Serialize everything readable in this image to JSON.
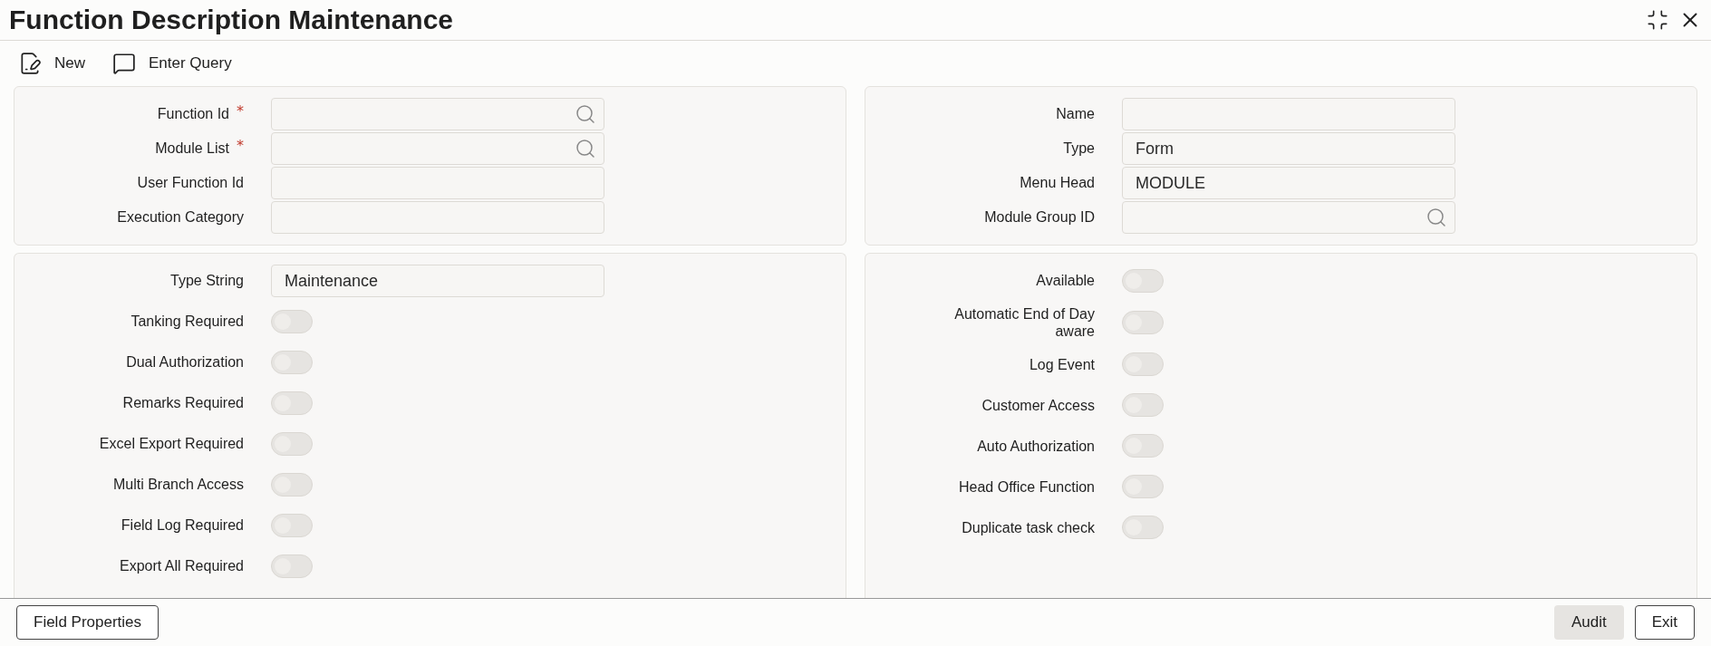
{
  "window": {
    "title": "Function Description Maintenance"
  },
  "toolbar": [
    {
      "kind": "new",
      "label": "New"
    },
    {
      "kind": "query",
      "label": "Enter Query"
    }
  ],
  "header_left": [
    {
      "label": "Function Id",
      "required_mark": "*",
      "lookup": true
    },
    {
      "label": "Module List",
      "required_mark": "*",
      "lookup": true
    },
    {
      "label": "User Function Id",
      "lookup": false
    },
    {
      "label": "Execution Category",
      "lookup": false
    }
  ],
  "header_right": [
    {
      "label": "Name",
      "lookup": false
    },
    {
      "label": "Type",
      "value": "Form",
      "lookup": false
    },
    {
      "label": "Menu Head",
      "value": "MODULE",
      "lookup": false
    },
    {
      "label": "Module Group ID",
      "lookup": true
    }
  ],
  "details_left": [
    {
      "kind": "field",
      "label": "Type String",
      "value": "Maintenance"
    },
    {
      "kind": "toggle",
      "label": "Tanking Required",
      "on": false
    },
    {
      "kind": "toggle",
      "label": "Dual Authorization",
      "on": false
    },
    {
      "kind": "toggle",
      "label": "Remarks Required",
      "on": false
    },
    {
      "kind": "toggle",
      "label": "Excel Export Required",
      "on": false
    },
    {
      "kind": "toggle",
      "label": "Multi Branch Access",
      "on": false
    },
    {
      "kind": "toggle",
      "label": "Field Log Required",
      "on": false
    },
    {
      "kind": "toggle",
      "label": "Export All Required",
      "on": false
    }
  ],
  "details_right": [
    {
      "kind": "toggle",
      "label": "Available",
      "on": false
    },
    {
      "kind": "toggle",
      "label": "Automatic End of Day aware",
      "on": false
    },
    {
      "kind": "toggle",
      "label": "Log Event",
      "on": false
    },
    {
      "kind": "toggle",
      "label": "Customer Access",
      "on": false
    },
    {
      "kind": "toggle",
      "label": "Auto Authorization",
      "on": false
    },
    {
      "kind": "toggle",
      "label": "Head Office Function",
      "on": false
    },
    {
      "kind": "toggle",
      "label": "Duplicate task check",
      "on": false
    }
  ],
  "footer": {
    "left": [
      {
        "kind": "outlined",
        "label": "Field Properties"
      }
    ],
    "right": [
      {
        "kind": "shaded",
        "label": "Audit"
      },
      {
        "kind": "outlined",
        "label": "Exit"
      }
    ]
  }
}
